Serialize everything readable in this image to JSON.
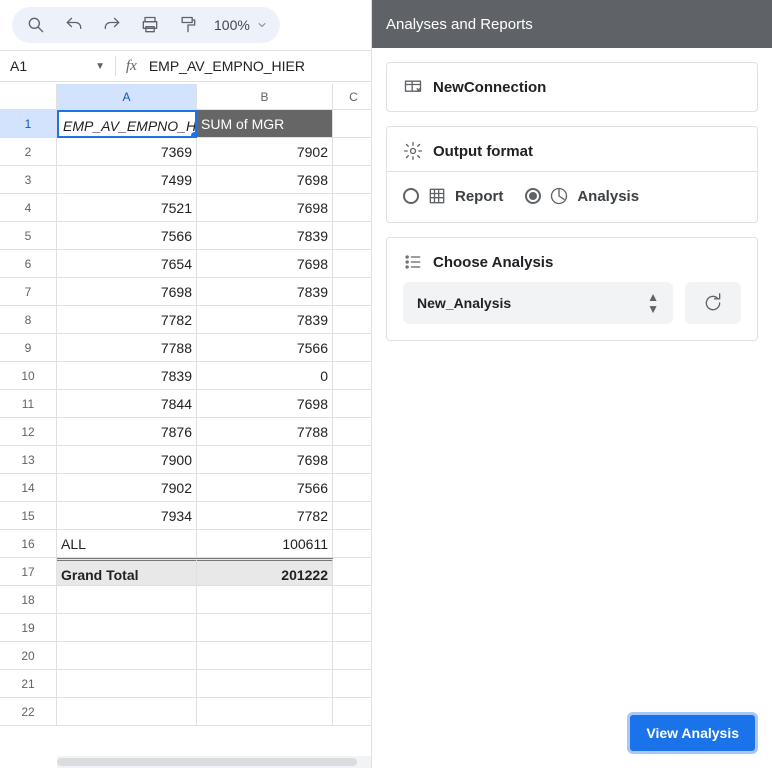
{
  "toolbar": {
    "zoom": "100%"
  },
  "fx": {
    "cellref": "A1",
    "formula": "EMP_AV_EMPNO_HIER"
  },
  "grid": {
    "columns": [
      "A",
      "B",
      "C"
    ],
    "selected_col": "A",
    "selected_row": "1",
    "rows": [
      {
        "n": "1",
        "a": "EMP_AV_EMPNO_HIER",
        "b": "SUM of MGR",
        "a_style": "sel_hdr",
        "b_style": "hdrB"
      },
      {
        "n": "2",
        "a": "7369",
        "b": "7902",
        "num": true
      },
      {
        "n": "3",
        "a": "7499",
        "b": "7698",
        "num": true
      },
      {
        "n": "4",
        "a": "7521",
        "b": "7698",
        "num": true
      },
      {
        "n": "5",
        "a": "7566",
        "b": "7839",
        "num": true
      },
      {
        "n": "6",
        "a": "7654",
        "b": "7698",
        "num": true
      },
      {
        "n": "7",
        "a": "7698",
        "b": "7839",
        "num": true
      },
      {
        "n": "8",
        "a": "7782",
        "b": "7839",
        "num": true
      },
      {
        "n": "9",
        "a": "7788",
        "b": "7566",
        "num": true
      },
      {
        "n": "10",
        "a": "7839",
        "b": "0",
        "num": true
      },
      {
        "n": "11",
        "a": "7844",
        "b": "7698",
        "num": true
      },
      {
        "n": "12",
        "a": "7876",
        "b": "7788",
        "num": true
      },
      {
        "n": "13",
        "a": "7900",
        "b": "7698",
        "num": true
      },
      {
        "n": "14",
        "a": "7902",
        "b": "7566",
        "num": true
      },
      {
        "n": "15",
        "a": "7934",
        "b": "7782",
        "num": true
      },
      {
        "n": "16",
        "a": "ALL",
        "b": "100611",
        "a_left": true,
        "b_num": true
      },
      {
        "n": "17",
        "a": "Grand Total",
        "b": "201222",
        "grand": true
      },
      {
        "n": "18",
        "a": "",
        "b": ""
      },
      {
        "n": "19",
        "a": "",
        "b": ""
      },
      {
        "n": "20",
        "a": "",
        "b": ""
      },
      {
        "n": "21",
        "a": "",
        "b": ""
      },
      {
        "n": "22",
        "a": "",
        "b": ""
      }
    ]
  },
  "panel": {
    "title": "Analyses and Reports",
    "new_connection": "NewConnection",
    "output_format": "Output format",
    "report_label": "Report",
    "analysis_label": "Analysis",
    "choose_analysis": "Choose Analysis",
    "selected_analysis": "New_Analysis",
    "view_btn": "View Analysis"
  }
}
